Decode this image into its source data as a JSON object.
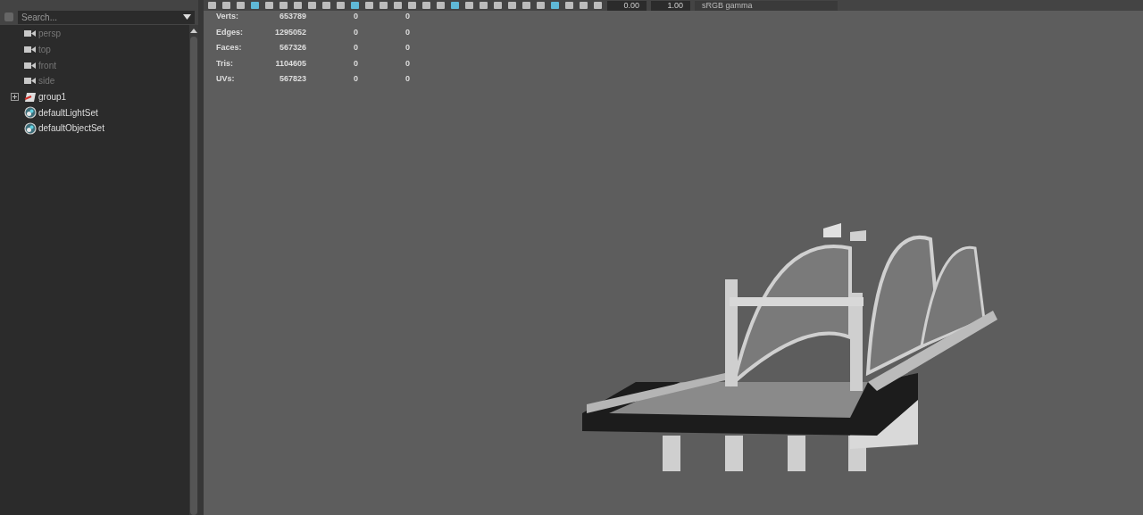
{
  "toolbar": {
    "fields": [
      "0.00",
      "1.00"
    ],
    "color_space": "sRGB gamma"
  },
  "outliner": {
    "search": {
      "placeholder": "Search..."
    },
    "items": [
      {
        "kind": "camera",
        "label": "persp",
        "dimmed": true,
        "expandable": false
      },
      {
        "kind": "camera",
        "label": "top",
        "dimmed": true,
        "expandable": false
      },
      {
        "kind": "camera",
        "label": "front",
        "dimmed": true,
        "expandable": false
      },
      {
        "kind": "camera",
        "label": "side",
        "dimmed": true,
        "expandable": false
      },
      {
        "kind": "group",
        "label": "group1",
        "dimmed": false,
        "expandable": true
      },
      {
        "kind": "set",
        "label": "defaultLightSet",
        "dimmed": false,
        "expandable": false
      },
      {
        "kind": "set",
        "label": "defaultObjectSet",
        "dimmed": false,
        "expandable": false
      }
    ]
  },
  "heads_up_display": {
    "rows": [
      {
        "label": "Verts:",
        "values": [
          "653789",
          "0",
          "0"
        ]
      },
      {
        "label": "Edges:",
        "values": [
          "1295052",
          "0",
          "0"
        ]
      },
      {
        "label": "Faces:",
        "values": [
          "567326",
          "0",
          "0"
        ]
      },
      {
        "label": "Tris:",
        "values": [
          "1104605",
          "0",
          "0"
        ]
      },
      {
        "label": "UVs:",
        "values": [
          "567823",
          "0",
          "0"
        ]
      }
    ]
  }
}
